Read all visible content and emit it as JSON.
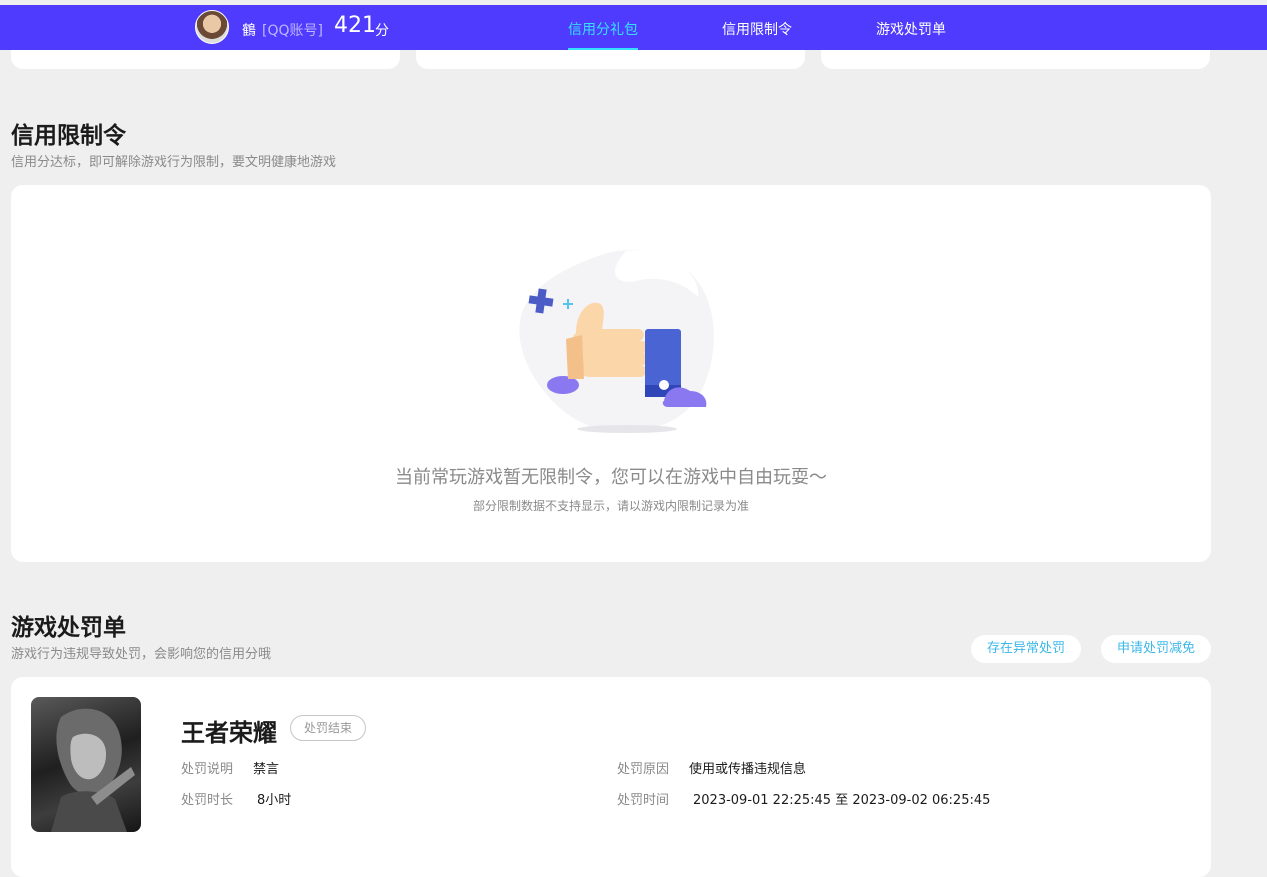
{
  "header": {
    "user_name": "鶴",
    "account_type": "[QQ账号]",
    "score": "421",
    "score_unit": "分",
    "tabs": [
      {
        "label": "信用分礼包",
        "active": true
      },
      {
        "label": "信用限制令",
        "active": false
      },
      {
        "label": "游戏处罚单",
        "active": false
      }
    ],
    "colors": {
      "bar": "#4f3bfd",
      "active_tab": "#35e0ff"
    }
  },
  "restriction": {
    "title": "信用限制令",
    "subtitle": "信用分达标，即可解除游戏行为限制，要文明健康地游戏",
    "empty_message": "当前常玩游戏暂无限制令，您可以在游戏中自由玩耍～",
    "empty_note": "部分限制数据不支持显示，请以游戏内限制记录为准",
    "illustration_icon": "thumbs-up-icon"
  },
  "punishments": {
    "title": "游戏处罚单",
    "subtitle": "游戏行为违规导致处罚，会影响您的信用分哦",
    "actions": [
      "存在异常处罚",
      "申请处罚减免"
    ],
    "items": [
      {
        "game": "王者荣耀",
        "status": "处罚结束",
        "desc_label": "处罚说明",
        "desc": "禁言",
        "duration_label": "处罚时长",
        "duration": "8小时",
        "reason_label": "处罚原因",
        "reason": "使用或传播违规信息",
        "time_label": "处罚时间",
        "time": "2023-09-01 22:25:45 至 2023-09-02 06:25:45"
      }
    ]
  }
}
